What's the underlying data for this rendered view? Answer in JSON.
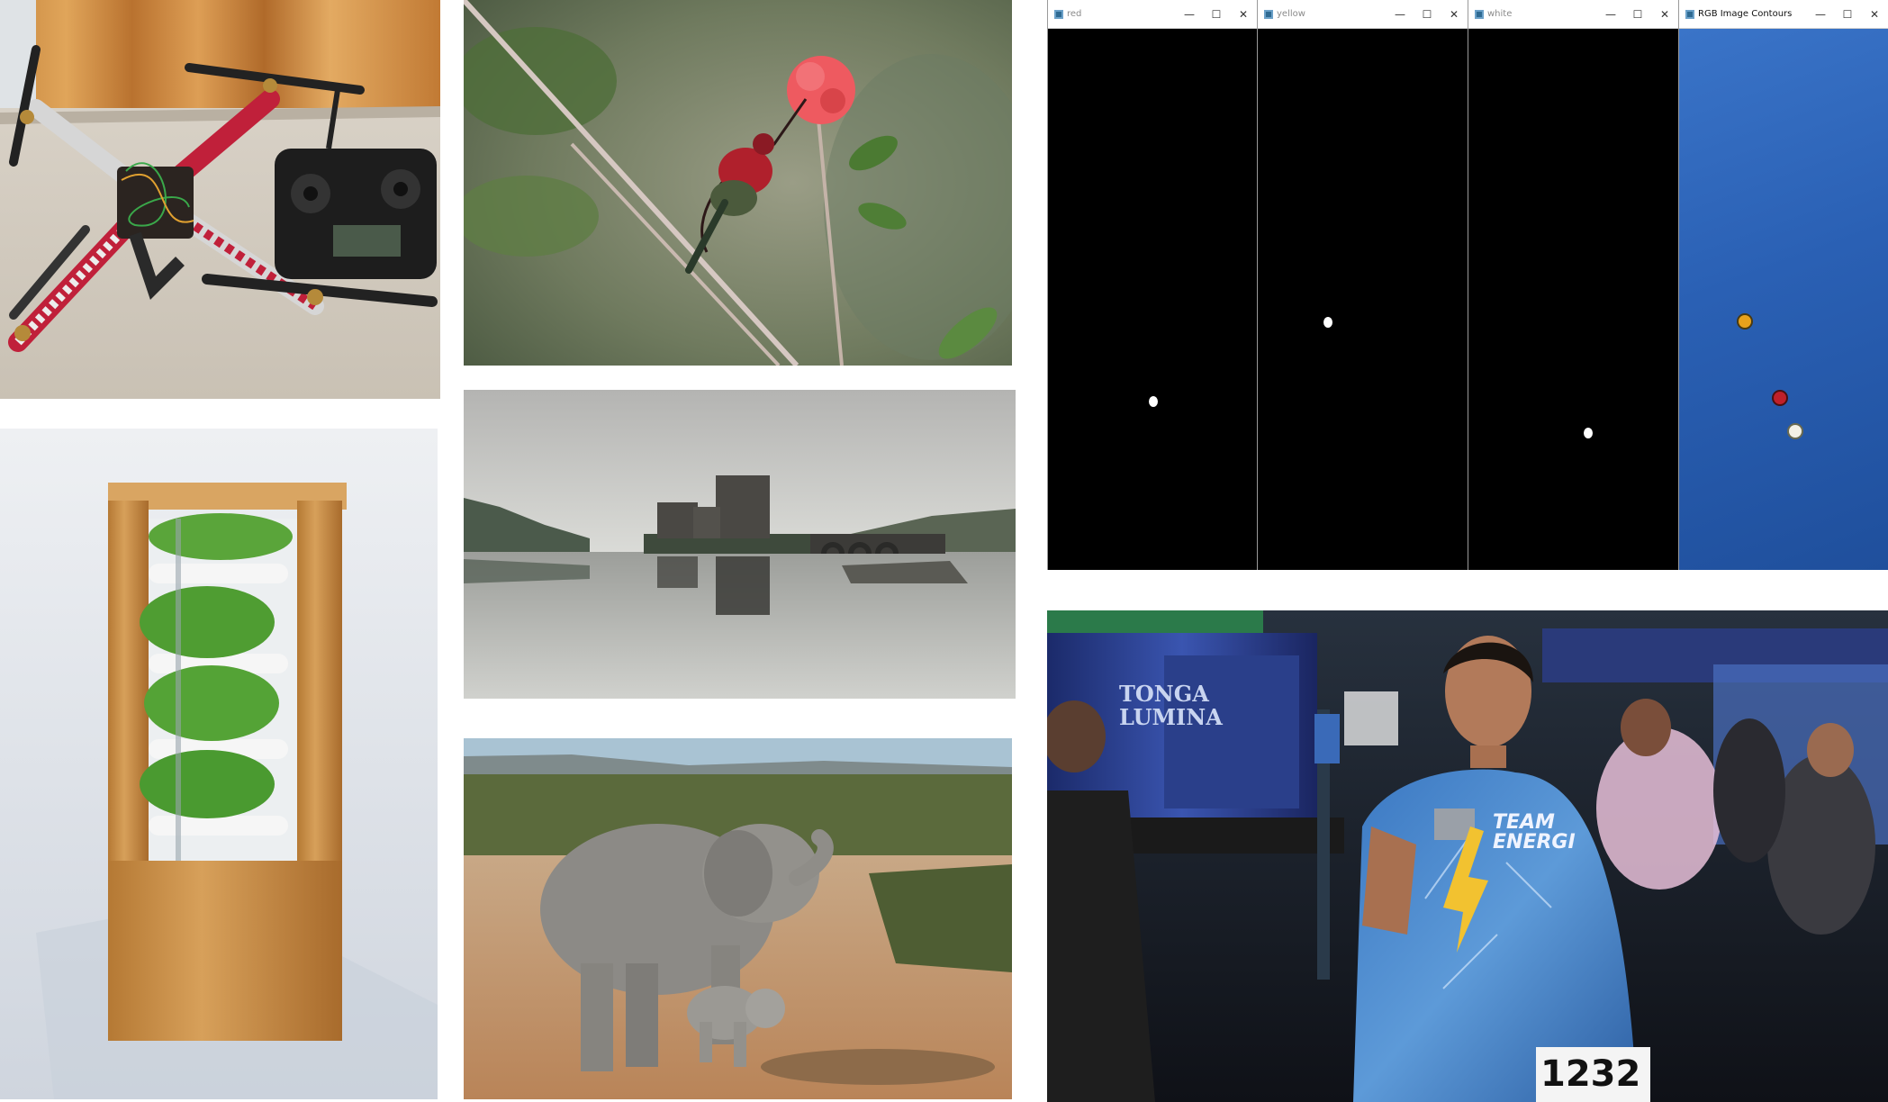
{
  "opencv_windows": [
    {
      "title": "red",
      "active": false,
      "ctl_min": "—",
      "ctl_max": "☐",
      "ctl_close": "✕"
    },
    {
      "title": "yellow",
      "active": false,
      "ctl_min": "—",
      "ctl_max": "☐",
      "ctl_close": "✕"
    },
    {
      "title": "white",
      "active": false,
      "ctl_min": "—",
      "ctl_max": "☐",
      "ctl_close": "✕"
    },
    {
      "title": "RGB Image Contours",
      "active": true,
      "ctl_min": "—",
      "ctl_max": "☐",
      "ctl_close": "✕"
    }
  ],
  "athlete_photo": {
    "banner_text": "TONGA LUMINA",
    "jersey_team": "TEAM ENERGI",
    "bib_number": "1232"
  },
  "colors": {
    "contour_bg": "#2a62b8",
    "mask_bg": "#000000",
    "dot_red": "#c0202a",
    "dot_yellow": "#e8a21c",
    "dot_white": "#f4f1e6"
  }
}
